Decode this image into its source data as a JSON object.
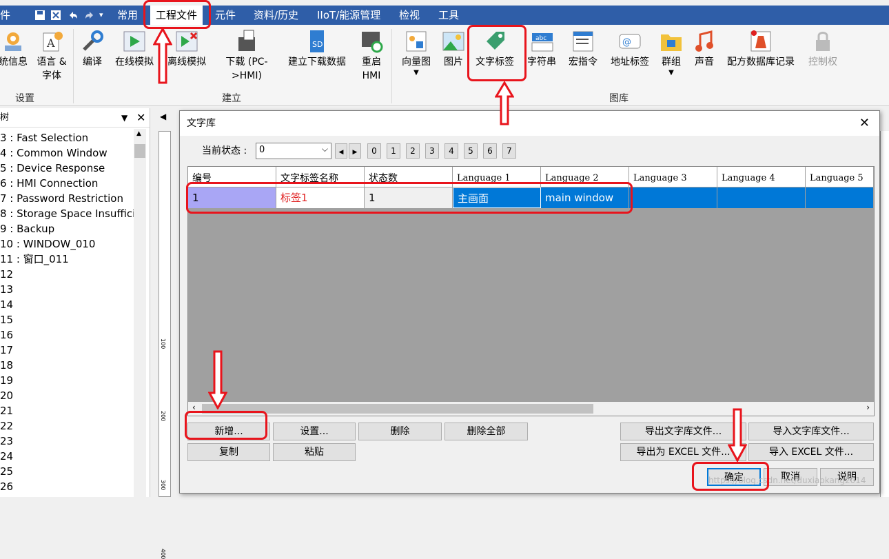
{
  "menubar": {
    "quick_icons": [
      "save-icon",
      "close-file-icon",
      "undo-icon",
      "redo-icon",
      "dropdown-icon"
    ],
    "items": [
      "件",
      "常用",
      "工程文件",
      "元件",
      "资料/历史",
      "IIoT/能源管理",
      "检视",
      "工具"
    ]
  },
  "ribbon": {
    "buttons": [
      {
        "label": "统信息"
      },
      {
        "label": "语言 &\n字体"
      },
      {
        "label": "编译"
      },
      {
        "label": "在线模拟"
      },
      {
        "label": "离线模拟"
      },
      {
        "label": "下载 (PC-\n>HMI)"
      },
      {
        "label": "建立下载数据"
      },
      {
        "label": "重启\nHMI"
      },
      {
        "label": "向量图"
      },
      {
        "label": "图片"
      },
      {
        "label": "文字标签"
      },
      {
        "label": "字符串"
      },
      {
        "label": "宏指令"
      },
      {
        "label": "地址标签"
      },
      {
        "label": "群组"
      },
      {
        "label": "声音"
      },
      {
        "label": "配方数据库记录"
      },
      {
        "label": "控制权"
      }
    ],
    "groups": [
      "设置",
      "建立",
      "图库"
    ]
  },
  "tree": {
    "header": "树",
    "items": [
      "3 : Fast Selection",
      "4 : Common Window",
      "5 : Device Response",
      "6 : HMI Connection",
      "7 : Password Restriction",
      "8 : Storage Space Insufficie",
      "9 : Backup",
      "10 : WINDOW_010",
      "11 : 窗口_011",
      "12",
      "13",
      "14",
      "15",
      "16",
      "17",
      "18",
      "19",
      "20",
      "21",
      "22",
      "23",
      "24",
      "25",
      "26"
    ]
  },
  "ruler": {
    "marks": [
      "100",
      "200",
      "300",
      "400"
    ]
  },
  "dialog": {
    "title": "文字库",
    "state_label": "当前状态 :",
    "state_value": "0",
    "state_buttons": [
      "0",
      "1",
      "2",
      "3",
      "4",
      "5",
      "6",
      "7"
    ],
    "columns": [
      "编号",
      "文字标签名称",
      "状态数",
      "Language 1",
      "Language 2",
      "Language 3",
      "Language 4",
      "Language 5"
    ],
    "rows": [
      {
        "id": "1",
        "name": "标签1",
        "states": "1",
        "lang1": "主画面",
        "lang2": "main window",
        "lang3": "",
        "lang4": "",
        "lang5": ""
      }
    ],
    "buttons": {
      "add": "新增...",
      "settings": "设置...",
      "delete": "删除",
      "delete_all": "删除全部",
      "copy": "复制",
      "paste": "粘贴",
      "export_lib": "导出文字库文件...",
      "import_lib": "导入文字库文件...",
      "export_excel": "导出为 EXCEL 文件...",
      "import_excel": "导入 EXCEL 文件...",
      "ok": "确定",
      "cancel": "取消",
      "help": "说明"
    }
  },
  "watermark": "https://blog.csdn.net/duxiaokang2014",
  "colors": {
    "accent": "#2f5ea8",
    "highlight": "#e8141c",
    "selection": "#0078d7"
  }
}
